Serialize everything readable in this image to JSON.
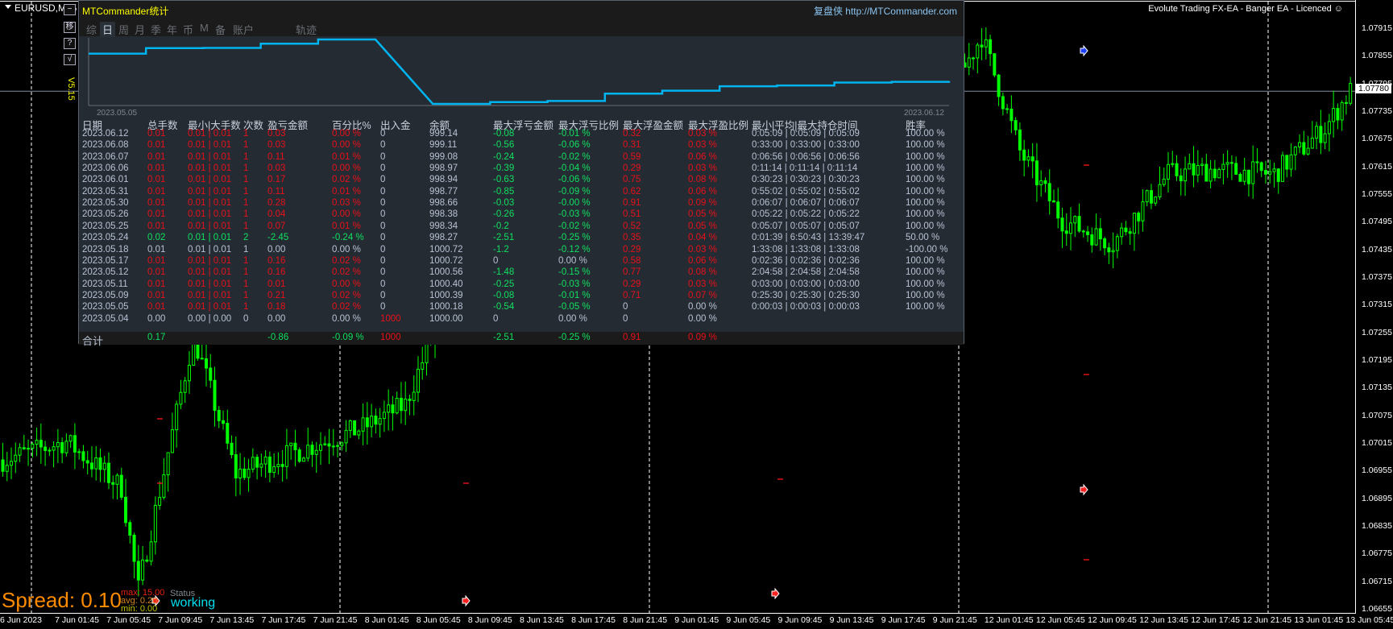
{
  "window": {
    "symbol": "EURUSD,M15",
    "ea_label": "Evolute Trading FX-EA - Banger EA - Licenced ☺",
    "version": "V5.15",
    "side_buttons": [
      "−",
      "移",
      "?",
      "√"
    ]
  },
  "panel": {
    "title": "MTCommander统计",
    "url": "复盘侠 http://MTCommander.com",
    "tabs": [
      "综",
      "日",
      "周",
      "月",
      "季",
      "年",
      "币",
      "M",
      "备",
      "账户",
      "轨迹"
    ],
    "active_tab": "日",
    "equity_start": "2023.05.05",
    "equity_end": "2023.06.12",
    "headers": [
      "日期",
      "总手数",
      "最小|大手数",
      "次数",
      "盈亏金额",
      "百分比%",
      "出入金",
      "余额",
      "最大浮亏金额",
      "最大浮亏比例",
      "最大浮盈金额",
      "最大浮盈比例",
      "最小|平均|最大持仓时间",
      "胜率"
    ],
    "rows": [
      {
        "c": [
          "2023.06.12",
          "0.01",
          "0.01 | 0.01",
          "1",
          "0.03",
          "0.00 %",
          "0",
          "999.14",
          "-0.08",
          "-0.01 %",
          "0.32",
          "0.03 %",
          "0:05:09 | 0:05:09 | 0:05:09",
          "100.00 %"
        ],
        "k": "wrrrrrwwggrrww"
      },
      {
        "c": [
          "2023.06.08",
          "0.01",
          "0.01 | 0.01",
          "1",
          "0.03",
          "0.00 %",
          "0",
          "999.11",
          "-0.56",
          "-0.06 %",
          "0.31",
          "0.03 %",
          "0:33:00 | 0:33:00 | 0:33:00",
          "100.00 %"
        ],
        "k": "wrrrrrwwggrrww"
      },
      {
        "c": [
          "2023.06.07",
          "0.01",
          "0.01 | 0.01",
          "1",
          "0.11",
          "0.01 %",
          "0",
          "999.08",
          "-0.24",
          "-0.02 %",
          "0.59",
          "0.06 %",
          "0:06:56 | 0:06:56 | 0:06:56",
          "100.00 %"
        ],
        "k": "wrrrrrwwggrrww"
      },
      {
        "c": [
          "2023.06.06",
          "0.01",
          "0.01 | 0.01",
          "1",
          "0.03",
          "0.00 %",
          "0",
          "998.97",
          "-0.39",
          "-0.04 %",
          "0.29",
          "0.03 %",
          "0:11:14 | 0:11:14 | 0:11:14",
          "100.00 %"
        ],
        "k": "wrrrrrwwggrrww"
      },
      {
        "c": [
          "2023.06.01",
          "0.01",
          "0.01 | 0.01",
          "1",
          "0.17",
          "0.02 %",
          "0",
          "998.94",
          "-0.63",
          "-0.06 %",
          "0.75",
          "0.08 %",
          "0:30:23 | 0:30:23 | 0:30:23",
          "100.00 %"
        ],
        "k": "wrrrrrwwggrrww"
      },
      {
        "c": [
          "2023.05.31",
          "0.01",
          "0.01 | 0.01",
          "1",
          "0.11",
          "0.01 %",
          "0",
          "998.77",
          "-0.85",
          "-0.09 %",
          "0.62",
          "0.06 %",
          "0:55:02 | 0:55:02 | 0:55:02",
          "100.00 %"
        ],
        "k": "wrrrrrwwggrrww"
      },
      {
        "c": [
          "2023.05.30",
          "0.01",
          "0.01 | 0.01",
          "1",
          "0.28",
          "0.03 %",
          "0",
          "998.66",
          "-0.03",
          "-0.00 %",
          "0.91",
          "0.09 %",
          "0:06:07 | 0:06:07 | 0:06:07",
          "100.00 %"
        ],
        "k": "wrrrrrwwggrrww"
      },
      {
        "c": [
          "2023.05.26",
          "0.01",
          "0.01 | 0.01",
          "1",
          "0.04",
          "0.00 %",
          "0",
          "998.38",
          "-0.26",
          "-0.03 %",
          "0.51",
          "0.05 %",
          "0:05:22 | 0:05:22 | 0:05:22",
          "100.00 %"
        ],
        "k": "wrrrrrwwggrrww"
      },
      {
        "c": [
          "2023.05.25",
          "0.01",
          "0.01 | 0.01",
          "1",
          "0.07",
          "0.01 %",
          "0",
          "998.34",
          "-0.2",
          "-0.02 %",
          "0.52",
          "0.05 %",
          "0:05:07 | 0:05:07 | 0:05:07",
          "100.00 %"
        ],
        "k": "wrrrrrwwggrrww"
      },
      {
        "c": [
          "2023.05.24",
          "0.02",
          "0.01 | 0.01",
          "2",
          "-2.45",
          "-0.24 %",
          "0",
          "998.27",
          "-2.51",
          "-0.25 %",
          "0.35",
          "0.04 %",
          "0:01:39 | 6:50:43 | 13:39:47",
          "50.00 %"
        ],
        "k": "wgggggwwggrrww"
      },
      {
        "c": [
          "2023.05.18",
          "0.01",
          "0.01 | 0.01",
          "1",
          "0.00",
          "0.00 %",
          "0",
          "1000.72",
          "-1.2",
          "-0.12 %",
          "0.29",
          "0.03 %",
          "1:33:08 | 1:33:08 | 1:33:08",
          "-100.00 %"
        ],
        "k": "wwwwwwwwggrrww"
      },
      {
        "c": [
          "2023.05.17",
          "0.01",
          "0.01 | 0.01",
          "1",
          "0.16",
          "0.02 %",
          "0",
          "1000.72",
          "0",
          "0.00 %",
          "0.58",
          "0.06 %",
          "0:02:36 | 0:02:36 | 0:02:36",
          "100.00 %"
        ],
        "k": "wrrrrrwwwwrrww"
      },
      {
        "c": [
          "2023.05.12",
          "0.01",
          "0.01 | 0.01",
          "1",
          "0.16",
          "0.02 %",
          "0",
          "1000.56",
          "-1.48",
          "-0.15 %",
          "0.77",
          "0.08 %",
          "2:04:58 | 2:04:58 | 2:04:58",
          "100.00 %"
        ],
        "k": "wrrrrrwwggrrww"
      },
      {
        "c": [
          "2023.05.11",
          "0.01",
          "0.01 | 0.01",
          "1",
          "0.01",
          "0.00 %",
          "0",
          "1000.40",
          "-0.25",
          "-0.03 %",
          "0.29",
          "0.03 %",
          "0:03:00 | 0:03:00 | 0:03:00",
          "100.00 %"
        ],
        "k": "wrrrrrwwggrrww"
      },
      {
        "c": [
          "2023.05.09",
          "0.01",
          "0.01 | 0.01",
          "1",
          "0.21",
          "0.02 %",
          "0",
          "1000.39",
          "-0.08",
          "-0.01 %",
          "0.71",
          "0.07 %",
          "0:25:30 | 0:25:30 | 0:25:30",
          "100.00 %"
        ],
        "k": "wrrrrrwwggrrww"
      },
      {
        "c": [
          "2023.05.05",
          "0.01",
          "0.01 | 0.01",
          "1",
          "0.18",
          "0.02 %",
          "0",
          "1000.18",
          "-0.54",
          "-0.05 %",
          "0",
          "0.00 %",
          "0:00:03 | 0:00:03 | 0:00:03",
          "100.00 %"
        ],
        "k": "wrrrrrwwggwwww"
      },
      {
        "c": [
          "2023.05.04",
          "0.00",
          "0.00 | 0.00",
          "0",
          "0.00",
          "0.00 %",
          "1000",
          "1000.00",
          "0",
          "0.00 %",
          "0",
          "0.00 %",
          "",
          ""
        ],
        "k": "wwwwwwrwwwwwww"
      }
    ],
    "total": {
      "c": [
        "合计",
        "0.17",
        "",
        "",
        "-0.86",
        "-0.09 %",
        "1000",
        "",
        "-2.51",
        "-0.25 %",
        "0.91",
        "0.09 %",
        "",
        ""
      ],
      "k": "wgwwggrwggrrww"
    }
  },
  "spread": {
    "label": "Spread: 0.10",
    "max": "max: 15.00",
    "avg": "avg: 0.20",
    "min": "min: 0.00",
    "status_label": "Status",
    "status": "working"
  },
  "price_axis": [
    "1.07915",
    "1.07855",
    "1.07795",
    "1.07735",
    "1.07675",
    "1.07615",
    "1.07555",
    "1.07495",
    "1.07435",
    "1.07375",
    "1.07315",
    "1.07255",
    "1.07195",
    "1.07135",
    "1.07075",
    "1.07015",
    "1.06955",
    "1.06895",
    "1.06835",
    "1.06775",
    "1.06715",
    "1.06655"
  ],
  "current_price": "1.07780",
  "time_axis": [
    "6 Jun 2023",
    "7 Jun 01:45",
    "7 Jun 05:45",
    "7 Jun 09:45",
    "7 Jun 13:45",
    "7 Jun 17:45",
    "7 Jun 21:45",
    "8 Jun 01:45",
    "8 Jun 05:45",
    "8 Jun 09:45",
    "8 Jun 13:45",
    "8 Jun 17:45",
    "8 Jun 21:45",
    "9 Jun 01:45",
    "9 Jun 05:45",
    "9 Jun 09:45",
    "9 Jun 13:45",
    "9 Jun 17:45",
    "9 Jun 21:45",
    "12 Jun 01:45",
    "12 Jun 05:45",
    "12 Jun 09:45",
    "12 Jun 13:45",
    "12 Jun 17:45",
    "12 Jun 21:45",
    "13 Jun 01:45",
    "13 Jun 05:45"
  ],
  "chart": {
    "candle_color": "#00ff00",
    "price_path": [
      [
        0,
        1.0698
      ],
      [
        15,
        1.0702
      ],
      [
        28,
        1.0692
      ],
      [
        32,
        1.067
      ],
      [
        45,
        1.0725
      ],
      [
        55,
        1.0695
      ],
      [
        70,
        1.07
      ],
      [
        85,
        1.0705
      ],
      [
        95,
        1.071
      ],
      [
        110,
        1.0745
      ],
      [
        150,
        1.0745
      ],
      [
        175,
        1.0745
      ],
      [
        190,
        1.0747
      ],
      [
        200,
        1.074
      ],
      [
        210,
        1.0736
      ],
      [
        225,
        1.078
      ],
      [
        231,
        1.079
      ],
      [
        240,
        1.0765
      ],
      [
        250,
        1.075
      ],
      [
        262,
        1.0745
      ],
      [
        275,
        1.076
      ],
      [
        285,
        1.0761
      ],
      [
        300,
        1.076
      ],
      [
        312,
        1.077
      ],
      [
        318,
        1.0778
      ]
    ]
  }
}
